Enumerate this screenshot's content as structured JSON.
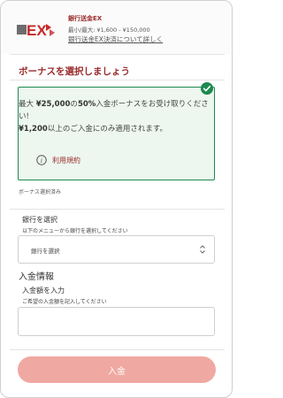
{
  "header": {
    "logo_text": "EX",
    "title": "銀行送金EX",
    "limits": "最小/最大: ¥1,600 - ¥150,000",
    "detail_link": "銀行送金EX決済について詳しく"
  },
  "bonus": {
    "section_title": "ボーナスを選択しましょう",
    "line1_pre": "最大 ",
    "line1_amount": "¥25,000",
    "line1_mid": "の",
    "line1_percent": "50%",
    "line1_post": "入金ボーナスをお受け取りください!",
    "line2_amount": "¥1,200",
    "line2_post": "以上のご入金にのみ適用されます。",
    "terms_link": "利用規約",
    "status": "ボーナス選択済み",
    "selected": true
  },
  "bank": {
    "label": "銀行を選択",
    "hint": "以下のメニューから銀行を選択してください",
    "selected_value": "銀行を選択"
  },
  "deposit": {
    "section_title": "入金情報",
    "amount_label": "入金額を入力",
    "amount_hint": "ご希望の入金額を記入してください",
    "amount_value": "",
    "submit_label": "入金"
  },
  "colors": {
    "brand_red": "#9b2c2c",
    "accent_green": "#1e8a4f",
    "card_bg": "#edf7ef",
    "button_bg": "#f0a8a2"
  },
  "icons": {
    "logo": "ex-logo-icon",
    "check": "check-icon",
    "info": "info-icon",
    "select": "updown-chevron-icon"
  }
}
